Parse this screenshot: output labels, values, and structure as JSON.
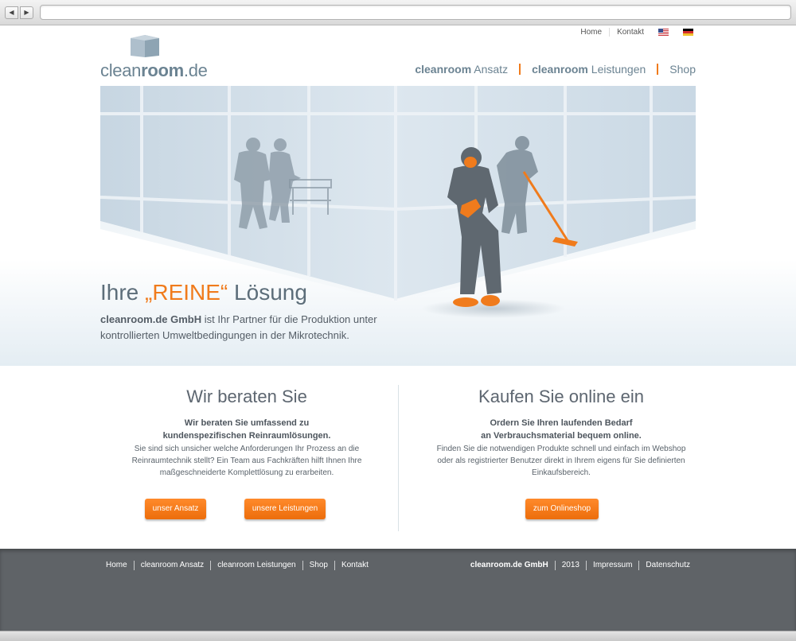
{
  "header": {
    "logo_part1": "clean",
    "logo_part2": "room",
    "logo_part3": ".de",
    "top_links": [
      "Home",
      "Kontakt"
    ],
    "nav": {
      "ansatz_bold": "cleanroom",
      "ansatz_rest": " Ansatz",
      "leistungen_bold": "cleanroom",
      "leistungen_rest": " Leistungen",
      "shop": "Shop"
    }
  },
  "hero": {
    "title_pre": "Ihre ",
    "title_accent": "„REINE“",
    "title_post": " Lösung",
    "text_bold": "cleanroom.de GmbH",
    "text_rest": " ist Ihr Partner für die Produktion unter kontrollierten Umweltbedingungen in der Mikrotechnik."
  },
  "left_col": {
    "heading": "Wir beraten Sie",
    "lead_line1": "Wir beraten Sie umfassend zu",
    "lead_line2": "kundenspezifischen Reinraumlösungen.",
    "body_line1": "Sie sind sich unsicher welche Anforderungen Ihr Prozess an die",
    "body_line2": "Reinraumtechnik stellt? Ein Team aus Fachkräften hilft Ihnen Ihre",
    "body_line3": "maßgeschneiderte Komplettlösung zu erarbeiten.",
    "button1": "unser Ansatz",
    "button2": "unsere Leistungen"
  },
  "right_col": {
    "heading": "Kaufen Sie online ein",
    "lead_line1": "Ordern Sie Ihren laufenden Bedarf",
    "lead_line2": "an Verbrauchsmaterial bequem online.",
    "body_line1": "Finden Sie die notwendigen Produkte schnell und einfach im Webshop",
    "body_line2": "oder als registrierter Benutzer direkt in Ihrem eigens für Sie definierten",
    "body_line3": "Einkaufsbereich.",
    "button": "zum Onlineshop"
  },
  "footer": {
    "left_links": [
      "Home",
      "cleanroom Ansatz",
      "cleanroom Leistungen",
      "Shop",
      "Kontakt"
    ],
    "company": "cleanroom.de GmbH",
    "year": "2013",
    "right_links": [
      "Impressum",
      "Datenschutz"
    ]
  },
  "icons": {
    "back": "back-arrow-icon",
    "forward": "forward-arrow-icon",
    "flag_en": "us-flag-icon",
    "flag_de": "german-flag-icon",
    "logo_cube": "cube-icon"
  },
  "colors": {
    "accent": "#f07b1c",
    "brand_text": "#6b8392",
    "footer_bg": "#5f6367"
  }
}
